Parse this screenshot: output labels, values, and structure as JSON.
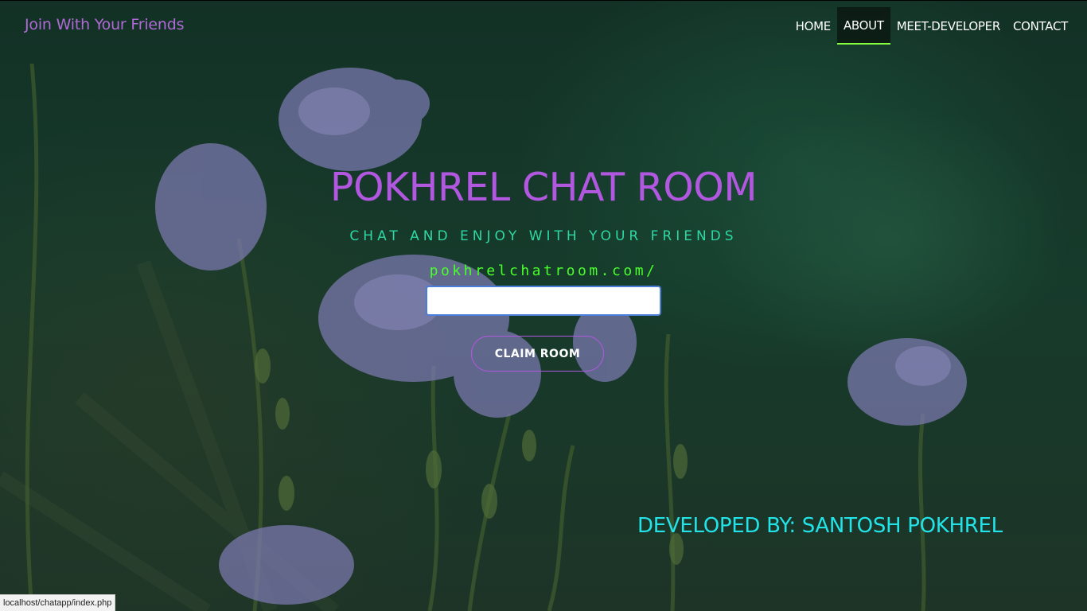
{
  "brand": {
    "label": "Join With Your Friends"
  },
  "nav": {
    "items": [
      {
        "label": "HOME",
        "active": false
      },
      {
        "label": "ABOUT",
        "active": true
      },
      {
        "label": "MEET-DEVELOPER",
        "active": false
      },
      {
        "label": "CONTACT",
        "active": false
      }
    ]
  },
  "hero": {
    "title": "POKHREL CHAT ROOM",
    "subtitle": "CHAT AND ENJOY WITH YOUR FRIENDS",
    "domain_prefix": "pokhrelchatroom.com/"
  },
  "room_form": {
    "input_value": "",
    "input_placeholder": "",
    "submit_label": "CLAIM ROOM"
  },
  "footer": {
    "developer_credit": "DEVELOPED BY: SANTOSH POKHREL"
  },
  "status_bar": {
    "url": "localhost/chatapp/index.php"
  },
  "colors": {
    "brand": "#b06ad6",
    "title": "#b257e0",
    "subtitle": "#2fd7a3",
    "domain": "#49ff2a",
    "credit": "#22e3e8",
    "nav_active_underline": "#86ff3c",
    "background": "#163b2b"
  },
  "background_image": {
    "subject": "purple-flax-flowers-on-green"
  }
}
